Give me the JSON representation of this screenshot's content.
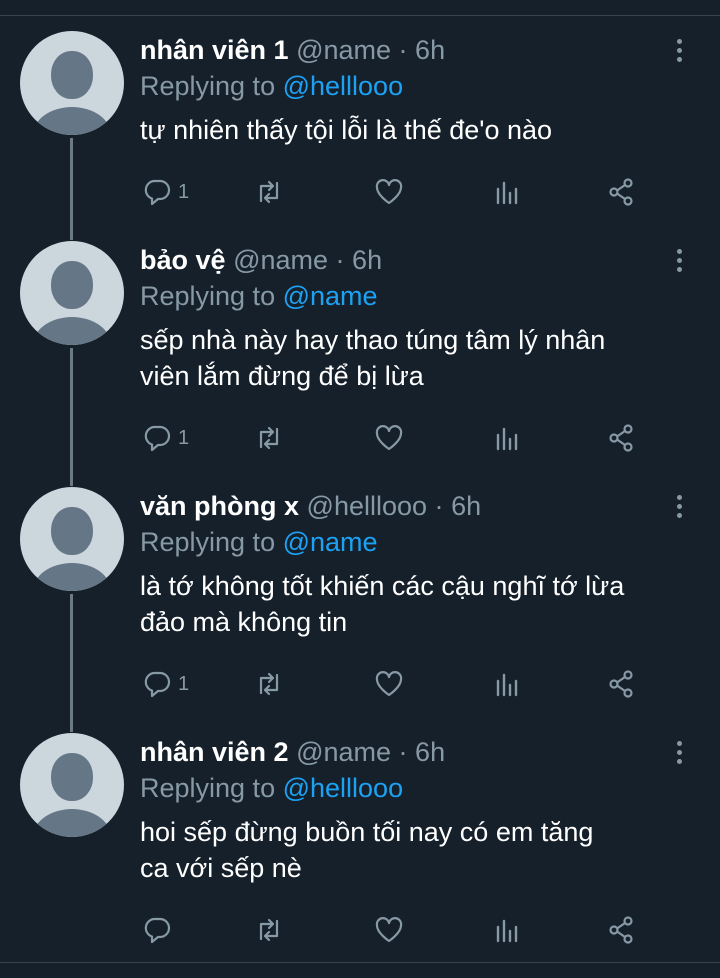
{
  "tweets": [
    {
      "name": "nhân viên 1",
      "handle": "@name",
      "dot": "·",
      "time": "6h",
      "replying_prefix": "Replying to",
      "replying_to": "@helllooo",
      "lines": [
        "tự nhiên thấy tội lỗi là thế đe'o nào"
      ],
      "reply_count": "1"
    },
    {
      "name": "bảo vệ",
      "handle": "@name",
      "dot": "·",
      "time": "6h",
      "replying_prefix": "Replying to",
      "replying_to": "@name",
      "lines": [
        "sếp nhà này hay thao túng tâm lý nhân",
        "viên lắm đừng để bị lừa"
      ],
      "reply_count": "1"
    },
    {
      "name": "văn phòng x",
      "handle": "@helllooo",
      "dot": "·",
      "time": "6h",
      "replying_prefix": "Replying to",
      "replying_to": "@name",
      "lines": [
        "là tớ không tốt khiến các cậu nghĩ tớ lừa",
        "đảo mà không tin"
      ],
      "reply_count": "1"
    },
    {
      "name": "nhân viên 2",
      "handle": "@name",
      "dot": "·",
      "time": "6h",
      "replying_prefix": "Replying to",
      "replying_to": "@helllooo",
      "lines": [
        "hoi sếp đừng buồn tối nay có em tăng",
        "ca với sếp nè"
      ],
      "reply_count": ""
    }
  ],
  "icons": [
    "reply-icon",
    "retweet-icon",
    "like-icon",
    "analytics-icon",
    "share-icon",
    "more-options-icon"
  ],
  "colors": {
    "background": "#15202b",
    "secondary_text": "#8899a6",
    "mention": "#1da1f2",
    "avatar_bg": "#ccd6dd",
    "avatar_fg": "#657786",
    "thread_line": "#6c7a84"
  }
}
